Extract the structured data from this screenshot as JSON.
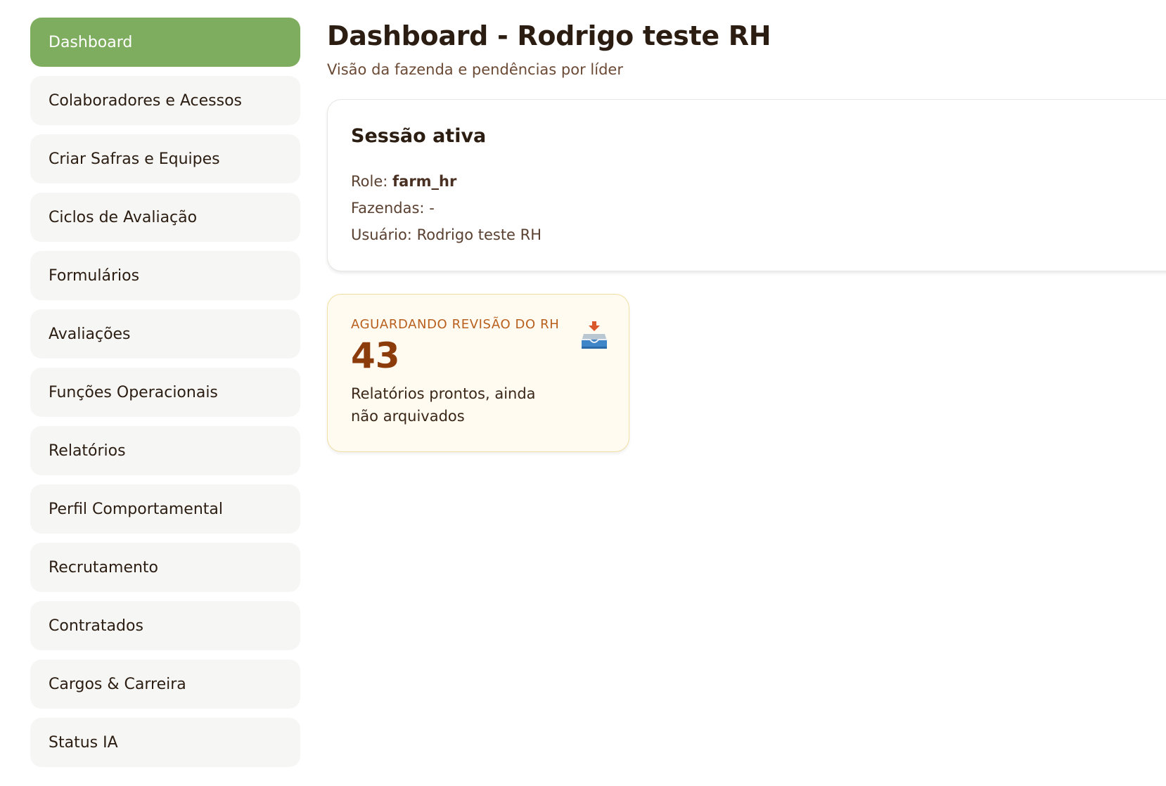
{
  "sidebar": {
    "items": [
      {
        "label": "Dashboard",
        "active": true
      },
      {
        "label": "Colaboradores e Acessos",
        "active": false
      },
      {
        "label": "Criar Safras e Equipes",
        "active": false
      },
      {
        "label": "Ciclos de Avaliação",
        "active": false
      },
      {
        "label": "Formulários",
        "active": false
      },
      {
        "label": "Avaliações",
        "active": false
      },
      {
        "label": "Funções Operacionais",
        "active": false
      },
      {
        "label": "Relatórios",
        "active": false
      },
      {
        "label": "Perfil Comportamental",
        "active": false
      },
      {
        "label": "Recrutamento",
        "active": false
      },
      {
        "label": "Contratados",
        "active": false
      },
      {
        "label": "Cargos & Carreira",
        "active": false
      },
      {
        "label": "Status IA",
        "active": false
      }
    ]
  },
  "header": {
    "title": "Dashboard - Rodrigo teste RH",
    "subtitle": "Visão da fazenda e pendências por líder"
  },
  "session": {
    "title": "Sessão ativa",
    "role_label": "Role:",
    "role_value": "farm_hr",
    "farms_label": "Fazendas:",
    "farms_value": "-",
    "user_label": "Usuário:",
    "user_value": "Rodrigo teste RH"
  },
  "stat": {
    "label": "AGUARDANDO REVISÃO DO RH",
    "value": "43",
    "description": "Relatórios prontos, ainda não arquivados",
    "icon": "inbox-tray-icon"
  },
  "colors": {
    "accent": "#7fad60",
    "nav_bg": "#f6f6f4",
    "stat_value": "#8c3b0b",
    "stat_label": "#b85f1d",
    "stat_bg": "#fffbf0"
  }
}
